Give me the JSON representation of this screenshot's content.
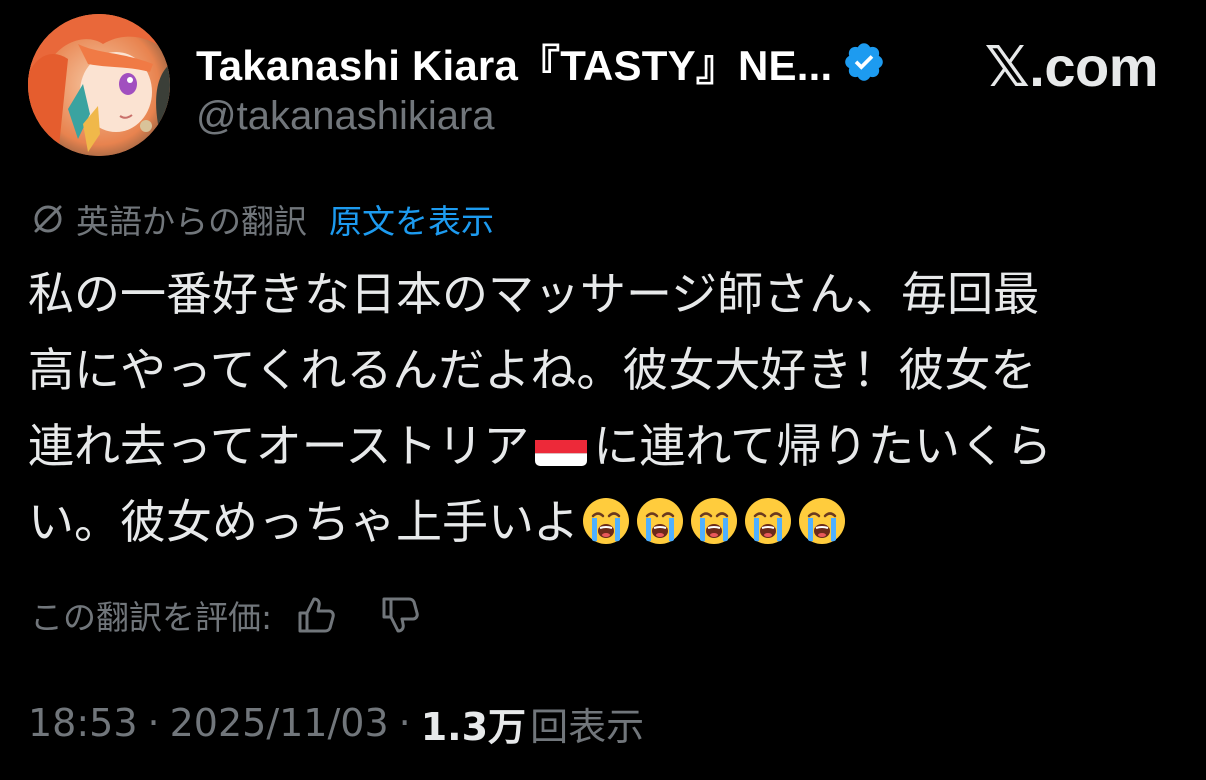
{
  "header": {
    "display_name": "Takanashi Kiara『TASTY』NE...",
    "handle": "@takanashikiara",
    "verified_icon": "verified-badge-icon",
    "site_label": "𝕏.com",
    "verified_color": "#1d9bf0"
  },
  "translation": {
    "icon": "translate-icon",
    "from_label": "英語からの翻訳",
    "show_original_label": "原文を表示"
  },
  "tweet": {
    "lines": [
      {
        "text": "私の一番好きな日本のマッサージ師さん、毎回最"
      },
      {
        "text": "高にやってくれるんだよね。彼女大好き！彼女を"
      },
      {
        "text_before_flag": "連れ去ってオーストリア",
        "flag": "austria-flag-icon",
        "text_after_flag": "に連れて帰りたいくら"
      },
      {
        "text": "い。彼女めっちゃ上手いよ",
        "emoji": "loudly-crying-face-icon",
        "emoji_count": 5
      }
    ]
  },
  "rating": {
    "label": "この翻訳を評価:",
    "thumbs_up_icon": "thumbs-up-icon",
    "thumbs_down_icon": "thumbs-down-icon"
  },
  "meta": {
    "time": "18:53",
    "separator": "·",
    "date": "2025/11/03",
    "views_count": "1.3万",
    "views_label": "回表示"
  },
  "colors": {
    "background": "#000000",
    "text_primary": "#e7e9ea",
    "text_secondary": "#71767b",
    "link": "#1d9bf0"
  }
}
